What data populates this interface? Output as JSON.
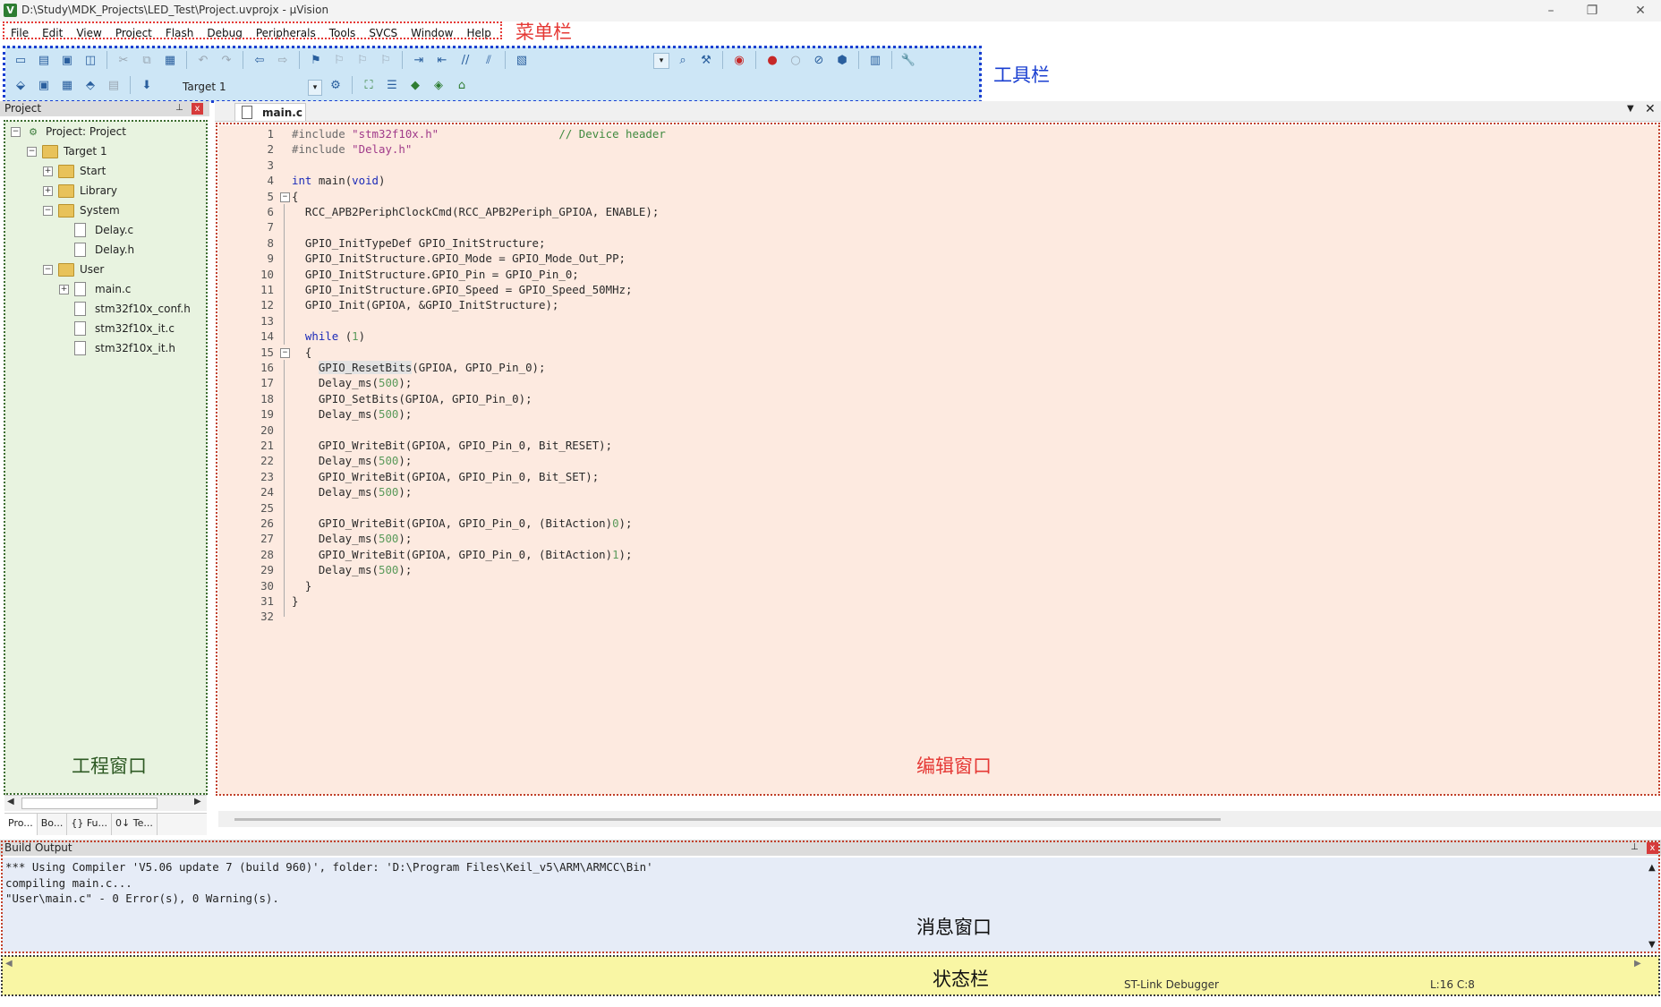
{
  "window": {
    "title": "D:\\Study\\MDK_Projects\\LED_Test\\Project.uvprojx - µVision",
    "app_icon_letter": "V",
    "minimize": "–",
    "restore": "❐",
    "close": "✕"
  },
  "menu": {
    "items": [
      "File",
      "Edit",
      "View",
      "Project",
      "Flash",
      "Debug",
      "Peripherals",
      "Tools",
      "SVCS",
      "Window",
      "Help"
    ],
    "annotation": "菜单栏"
  },
  "toolbar": {
    "annotation": "工具栏",
    "target_value": "Target 1",
    "dropdown_arrow": "▾"
  },
  "project_panel": {
    "title": "Project",
    "pin": "📌",
    "close": "x",
    "annotation": "工程窗口",
    "tree": [
      {
        "label": "Project: Project",
        "toggle": "−",
        "icon": "project-icon"
      },
      {
        "label": "Target 1",
        "toggle": "−",
        "icon": "target-icon"
      },
      {
        "label": "Start",
        "toggle": "+",
        "icon": "folder-icon"
      },
      {
        "label": "Library",
        "toggle": "+",
        "icon": "folder-icon"
      },
      {
        "label": "System",
        "toggle": "−",
        "icon": "folder-icon"
      },
      {
        "label": "Delay.c",
        "toggle": "",
        "icon": "file-icon"
      },
      {
        "label": "Delay.h",
        "toggle": "",
        "icon": "file-icon"
      },
      {
        "label": "User",
        "toggle": "−",
        "icon": "folder-icon"
      },
      {
        "label": "main.c",
        "toggle": "+",
        "icon": "file-icon"
      },
      {
        "label": "stm32f10x_conf.h",
        "toggle": "",
        "icon": "file-icon"
      },
      {
        "label": "stm32f10x_it.c",
        "toggle": "",
        "icon": "file-icon"
      },
      {
        "label": "stm32f10x_it.h",
        "toggle": "",
        "icon": "file-icon"
      }
    ],
    "tabs": [
      "Pro...",
      "Bo...",
      "{} Fu...",
      "0↓ Te..."
    ]
  },
  "editor": {
    "tab_label": "main.c",
    "annotation": "编辑窗口",
    "menu_arrow": "▼",
    "close": "✕",
    "lines": [
      {
        "n": "1",
        "fold": "",
        "html": "<span class=\"pp\">#include</span> <span class=\"str\">\"stm32f10x.h\"</span>                  <span class=\"cmt\">// Device header</span>"
      },
      {
        "n": "2",
        "fold": "",
        "html": "<span class=\"pp\">#include</span> <span class=\"str\">\"Delay.h\"</span>"
      },
      {
        "n": "3",
        "fold": "",
        "html": ""
      },
      {
        "n": "4",
        "fold": "",
        "html": "<span class=\"kw\">int</span> main(<span class=\"kw\">void</span>)"
      },
      {
        "n": "5",
        "fold": "−",
        "html": "{"
      },
      {
        "n": "6",
        "fold": "|",
        "html": "  RCC_APB2PeriphClockCmd(RCC_APB2Periph_GPIOA, ENABLE);"
      },
      {
        "n": "7",
        "fold": "|",
        "html": ""
      },
      {
        "n": "8",
        "fold": "|",
        "html": "  GPIO_InitTypeDef GPIO_InitStructure;"
      },
      {
        "n": "9",
        "fold": "|",
        "html": "  GPIO_InitStructure.GPIO_Mode = GPIO_Mode_Out_PP;"
      },
      {
        "n": "10",
        "fold": "|",
        "html": "  GPIO_InitStructure.GPIO_Pin = GPIO_Pin_0;"
      },
      {
        "n": "11",
        "fold": "|",
        "html": "  GPIO_InitStructure.GPIO_Speed = GPIO_Speed_50MHz;"
      },
      {
        "n": "12",
        "fold": "|",
        "html": "  GPIO_Init(GPIOA, &amp;GPIO_InitStructure);"
      },
      {
        "n": "13",
        "fold": "|",
        "html": ""
      },
      {
        "n": "14",
        "fold": "|",
        "html": "  <span class=\"kw\">while</span> (<span class=\"num\">1</span>)"
      },
      {
        "n": "15",
        "fold": "−",
        "html": "  {"
      },
      {
        "n": "16",
        "fold": "|",
        "html": "    <span class=\"hl\">GPIO_ResetBits</span>(GPIOA, GPIO_Pin_0);"
      },
      {
        "n": "17",
        "fold": "|",
        "html": "    Delay_ms(<span class=\"num\">500</span>);"
      },
      {
        "n": "18",
        "fold": "|",
        "html": "    GPIO_SetBits(GPIOA, GPIO_Pin_0);"
      },
      {
        "n": "19",
        "fold": "|",
        "html": "    Delay_ms(<span class=\"num\">500</span>);"
      },
      {
        "n": "20",
        "fold": "|",
        "html": ""
      },
      {
        "n": "21",
        "fold": "|",
        "html": "    GPIO_WriteBit(GPIOA, GPIO_Pin_0, Bit_RESET);"
      },
      {
        "n": "22",
        "fold": "|",
        "html": "    Delay_ms(<span class=\"num\">500</span>);"
      },
      {
        "n": "23",
        "fold": "|",
        "html": "    GPIO_WriteBit(GPIOA, GPIO_Pin_0, Bit_SET);"
      },
      {
        "n": "24",
        "fold": "|",
        "html": "    Delay_ms(<span class=\"num\">500</span>);"
      },
      {
        "n": "25",
        "fold": "|",
        "html": ""
      },
      {
        "n": "26",
        "fold": "|",
        "html": "    GPIO_WriteBit(GPIOA, GPIO_Pin_0, (BitAction)<span class=\"num\">0</span>);"
      },
      {
        "n": "27",
        "fold": "|",
        "html": "    Delay_ms(<span class=\"num\">500</span>);"
      },
      {
        "n": "28",
        "fold": "|",
        "html": "    GPIO_WriteBit(GPIOA, GPIO_Pin_0, (BitAction)<span class=\"num\">1</span>);"
      },
      {
        "n": "29",
        "fold": "|",
        "html": "    Delay_ms(<span class=\"num\">500</span>);"
      },
      {
        "n": "30",
        "fold": "-",
        "html": "  }"
      },
      {
        "n": "31",
        "fold": "|",
        "html": "}"
      },
      {
        "n": "32",
        "fold": "L",
        "html": ""
      }
    ]
  },
  "build_output": {
    "title": "Build Output",
    "pin": "📌",
    "close": "x",
    "annotation": "消息窗口",
    "lines": [
      "*** Using Compiler 'V5.06 update 7 (build 960)', folder: 'D:\\Program Files\\Keil_v5\\ARM\\ARMCC\\Bin'",
      "compiling main.c...",
      "\"User\\main.c\" - 0 Error(s), 0 Warning(s)."
    ]
  },
  "status_bar": {
    "annotation": "状态栏",
    "debugger": "ST-Link Debugger",
    "position": "L:16 C:8"
  },
  "colors": {
    "menu_outline": "#e53935",
    "toolbar_outline": "#1a3fd1",
    "project_bg": "#e8f3e0",
    "editor_bg": "#fdeae0",
    "build_bg": "#e6ecf7",
    "status_bg": "#f9f6a4"
  }
}
